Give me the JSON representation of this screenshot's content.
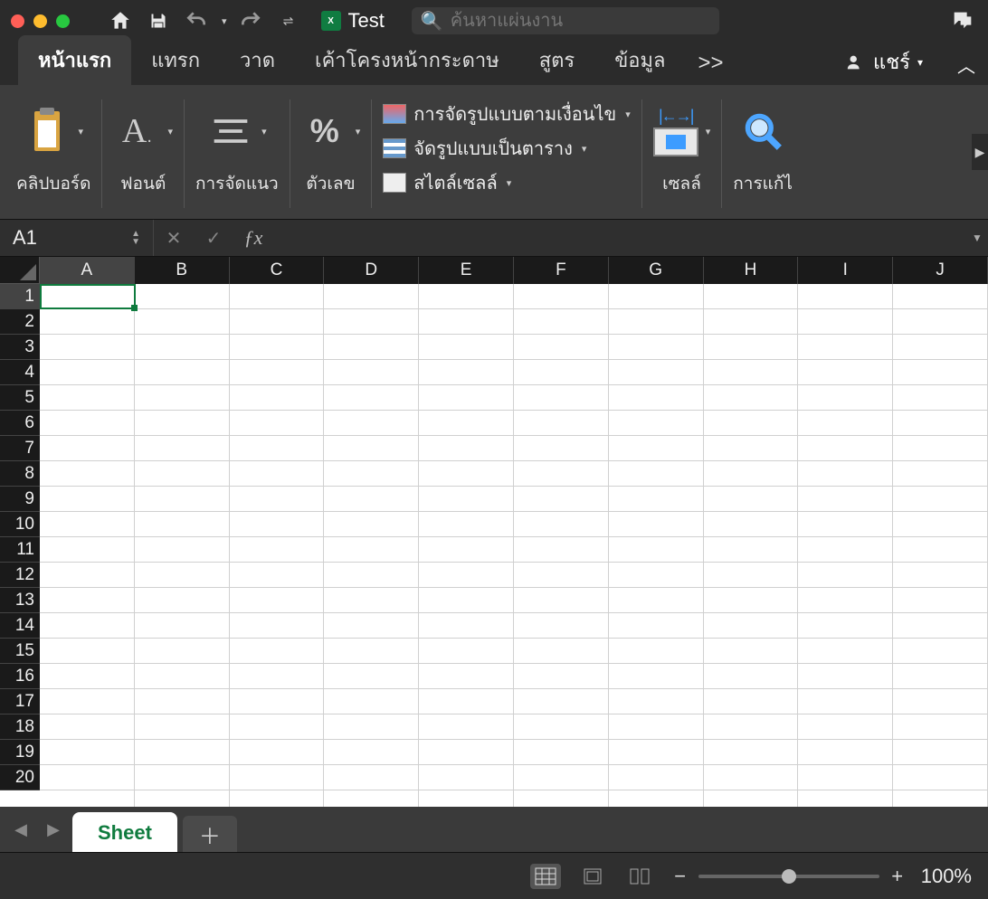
{
  "title": "Test",
  "search_placeholder": "ค้นหาแผ่นงาน",
  "tabs": {
    "home": "หน้าแรก",
    "insert": "แทรก",
    "draw": "วาด",
    "page_layout": "เค้าโครงหน้ากระดาษ",
    "formulas": "สูตร",
    "data": "ข้อมูล",
    "more": ">>",
    "share": "แชร์"
  },
  "ribbon": {
    "clipboard": "คลิปบอร์ด",
    "font": "ฟอนต์",
    "alignment": "การจัดแนว",
    "number": "ตัวเลข",
    "conditional": "การจัดรูปแบบตามเงื่อนไข",
    "format_table": "จัดรูปแบบเป็นตาราง",
    "cell_styles": "สไตล์เซลล์",
    "cells": "เซลล์",
    "editing": "การแก้ไ"
  },
  "name_box": "A1",
  "columns": [
    "A",
    "B",
    "C",
    "D",
    "E",
    "F",
    "G",
    "H",
    "I",
    "J"
  ],
  "rows": [
    "1",
    "2",
    "3",
    "4",
    "5",
    "6",
    "7",
    "8",
    "9",
    "10",
    "11",
    "12",
    "13",
    "14",
    "15",
    "16",
    "17",
    "18",
    "19",
    "20"
  ],
  "sheet_tab": "Sheet",
  "zoom": "100%"
}
